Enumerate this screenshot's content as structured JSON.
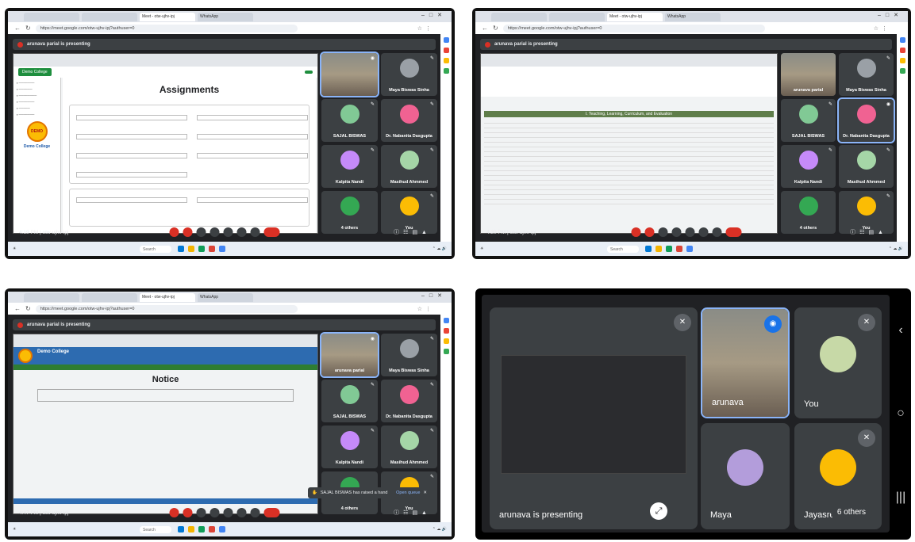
{
  "screenshots": [
    {
      "presenting": "arunava parial is presenting",
      "time": "4:19 PM | otw-ujhv-ipj",
      "page_title": "Assignments",
      "logo_text": "DEMO",
      "college_name": "Demo College",
      "tiles": [
        {
          "name": "",
          "kind": "speaker"
        },
        {
          "name": "Maya Biswas Sinha"
        },
        {
          "name": "SAJAL BISWAS"
        },
        {
          "name": "Dr. Nabanita Dasgupta"
        },
        {
          "name": "Kalpita Nandi"
        },
        {
          "name": "Masihud Ahmmed"
        },
        {
          "name": "4 others"
        },
        {
          "name": "You"
        }
      ]
    },
    {
      "presenting": "arunava parial is presenting",
      "time": "4:30 PM | otw-ujhv-ipj",
      "section_heading": "I. Teaching, Learning, Curriculum, and Evaluation",
      "tiles": [
        {
          "name": "arunava parial"
        },
        {
          "name": "Maya Biswas Sinha"
        },
        {
          "name": "SAJAL BISWAS"
        },
        {
          "name": "Dr. Nabanita Dasgupta"
        },
        {
          "name": "Kalpita Nandi"
        },
        {
          "name": "Masihud Ahmmed"
        },
        {
          "name": "4 others"
        },
        {
          "name": "You"
        }
      ]
    },
    {
      "presenting": "arunava parial is presenting",
      "time": "4:47 PM | otw-ujhv-ipj",
      "page_title": "Notice",
      "college_name": "Demo College",
      "toast": "SAJAL BISWAS has raised a hand",
      "toast_action": "Open queue",
      "tiles": [
        {
          "name": "arunava parial"
        },
        {
          "name": "Maya Biswas Sinha"
        },
        {
          "name": "SAJAL BISWAS"
        },
        {
          "name": "Dr. Nabanita Dasgupta"
        },
        {
          "name": "Kalpita Nandi"
        },
        {
          "name": "Masihud Ahmmed"
        },
        {
          "name": "4 others"
        },
        {
          "name": "You"
        }
      ]
    }
  ],
  "phone": {
    "presenting": "arunava is presenting",
    "tiles": [
      {
        "name": "arunava"
      },
      {
        "name": "You"
      },
      {
        "name": "Maya"
      },
      {
        "name": "Jayasree"
      }
    ],
    "others": "6 others"
  },
  "browser": {
    "url": "https://meet.google.com/otw-ujhv-ipj?authuser=0",
    "tab_active": "Meet - otw-ujhv-ipj",
    "tab_other": "WhatsApp",
    "search_placeholder": "Search"
  },
  "colors": {
    "meet_bg": "#202124",
    "tile_bg": "#3c4043",
    "end_call": "#d93025",
    "accent_blue": "#8ab4f8"
  }
}
